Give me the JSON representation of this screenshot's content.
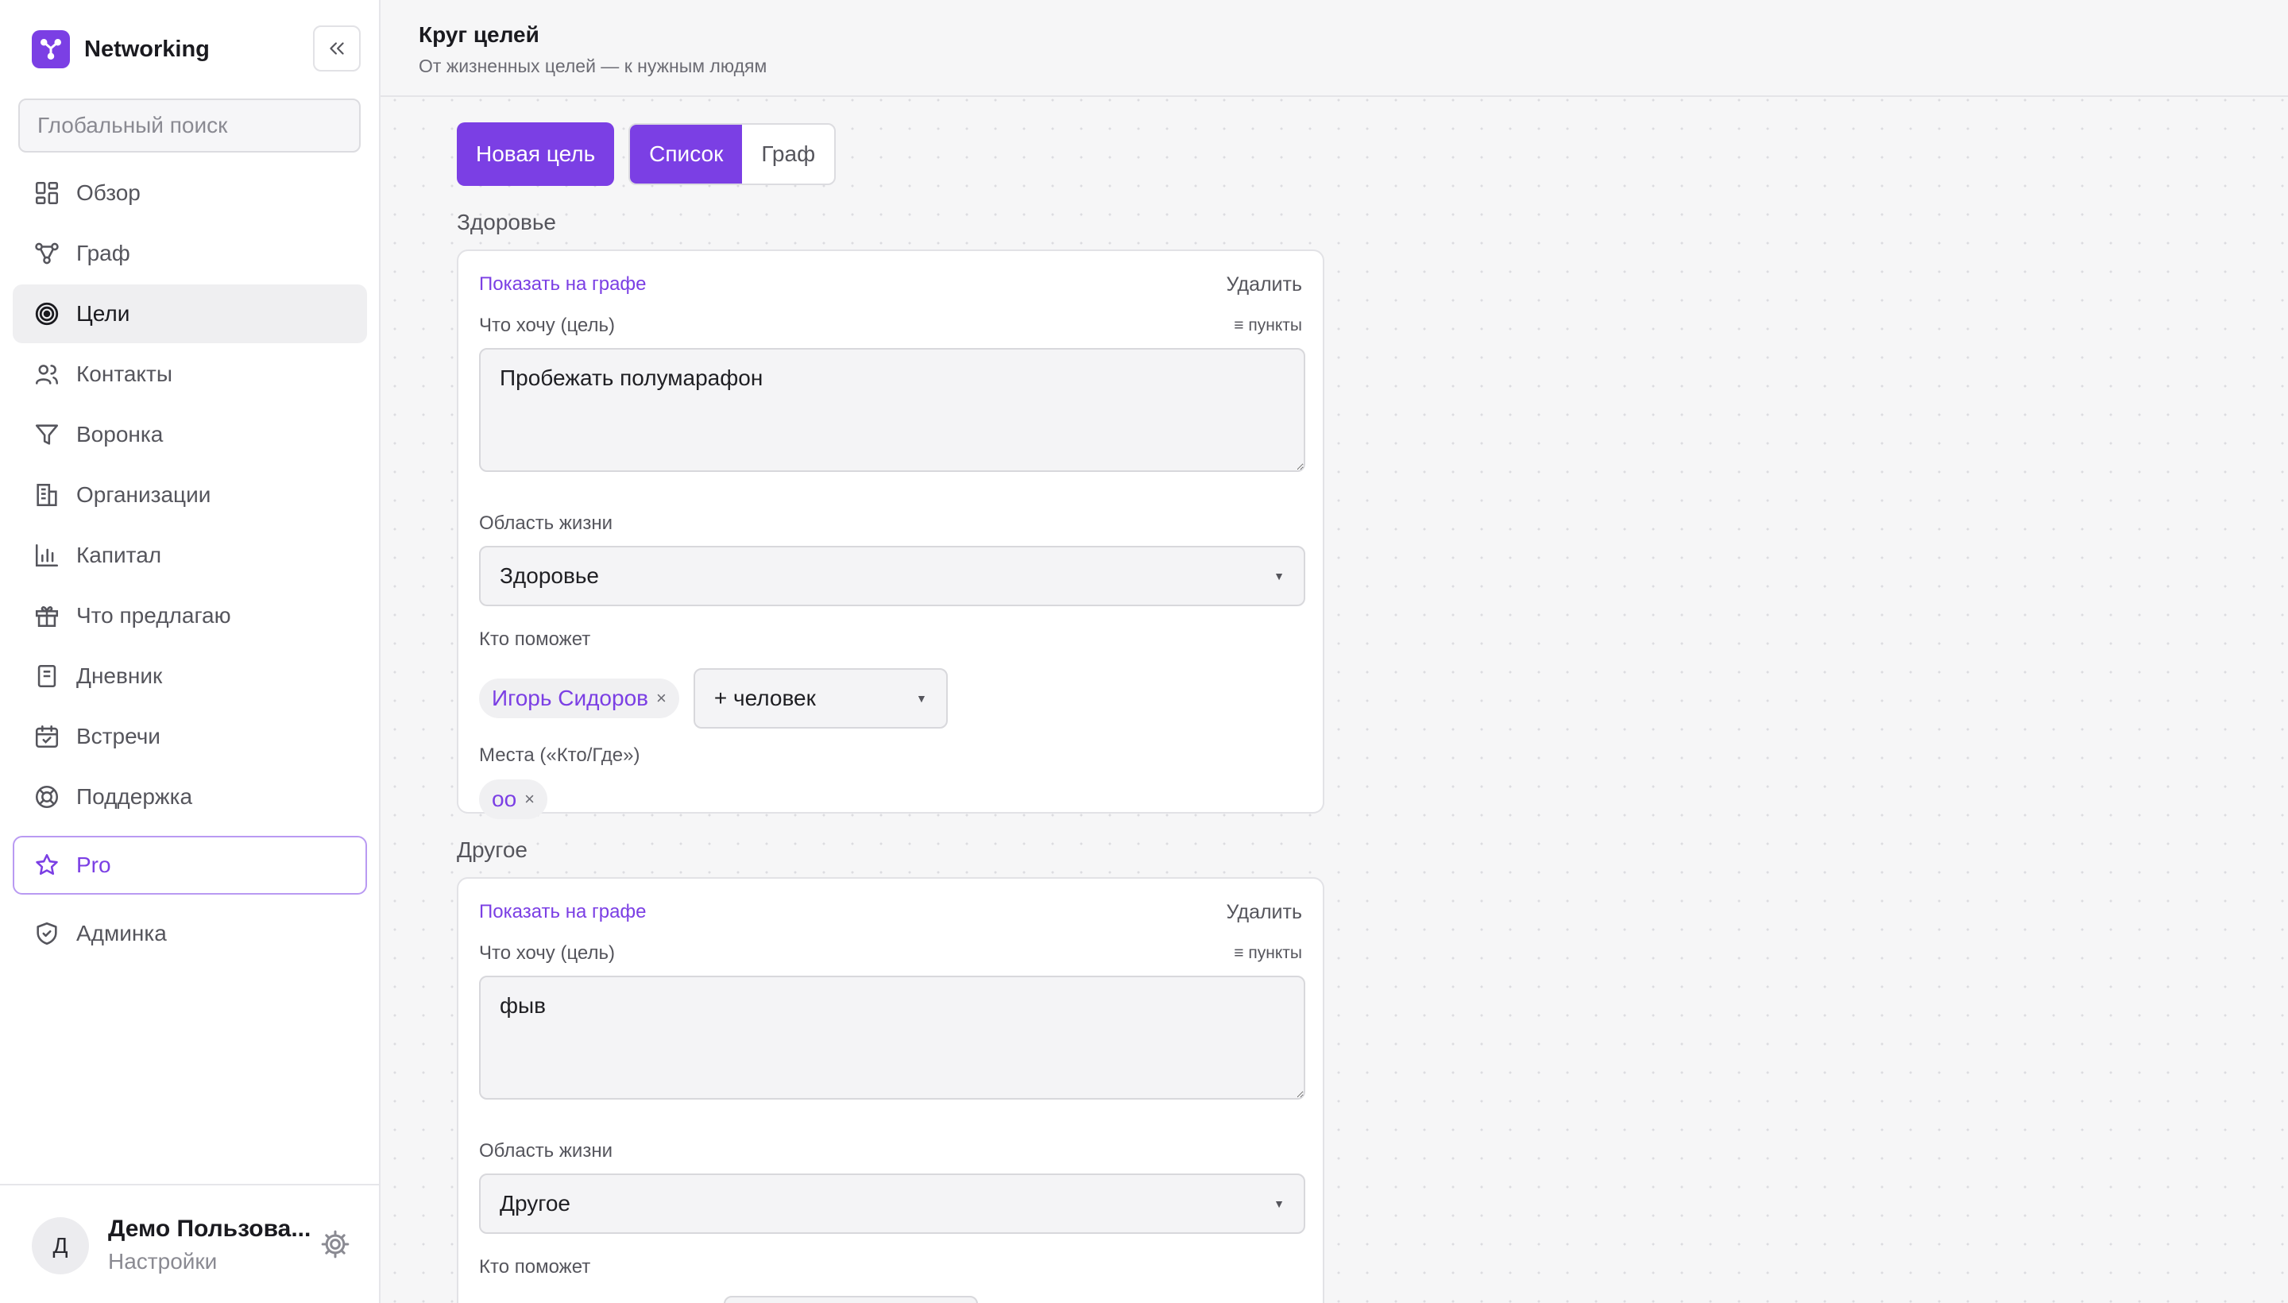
{
  "brand": {
    "name": "Networking"
  },
  "search": {
    "placeholder": "Глобальный поиск"
  },
  "nav": [
    {
      "label": "Обзор",
      "icon": "dashboard-icon"
    },
    {
      "label": "Граф",
      "icon": "graph-icon"
    },
    {
      "label": "Цели",
      "icon": "target-icon",
      "active": true
    },
    {
      "label": "Контакты",
      "icon": "users-icon"
    },
    {
      "label": "Воронка",
      "icon": "funnel-icon"
    },
    {
      "label": "Организации",
      "icon": "building-icon"
    },
    {
      "label": "Капитал",
      "icon": "bar-chart-icon"
    },
    {
      "label": "Что предлагаю",
      "icon": "gift-icon"
    },
    {
      "label": "Дневник",
      "icon": "notebook-icon"
    },
    {
      "label": "Встречи",
      "icon": "calendar-icon"
    },
    {
      "label": "Поддержка",
      "icon": "lifebuoy-icon"
    },
    {
      "label": "Pro",
      "icon": "star-icon"
    },
    {
      "label": "Админка",
      "icon": "shield-icon"
    }
  ],
  "user": {
    "initial": "Д",
    "name": "Демо Пользова...",
    "settings_label": "Настройки"
  },
  "header": {
    "title": "Круг целей",
    "subtitle": "От жизненных целей — к нужным людям"
  },
  "toolbar": {
    "new_goal": "Новая цель",
    "view_list": "Список",
    "view_graph": "Граф",
    "active_view": "Список"
  },
  "groups": [
    {
      "title": "Здоровье",
      "show_on_graph": "Показать на графе",
      "delete": "Удалить",
      "goal_label": "Что хочу (цель)",
      "points_label": "≡ пункты",
      "goal_text": "Пробежать полумарафон",
      "area_label": "Область жизни",
      "area_value": "Здоровье",
      "helpers_label": "Кто поможет",
      "helpers": [
        "Игорь Сидоров"
      ],
      "add_person": "+ человек",
      "places_label": "Места («Кто/Где»)",
      "places": [
        "оо"
      ]
    },
    {
      "title": "Другое",
      "show_on_graph": "Показать на графе",
      "delete": "Удалить",
      "goal_label": "Что хочу (цель)",
      "points_label": "≡ пункты",
      "goal_text": "фыв",
      "area_label": "Область жизни",
      "area_value": "Другое",
      "helpers_label": "Кто поможет"
    }
  ],
  "colors": {
    "accent": "#7b3fe4",
    "sidebar_active_bg": "#efeff1",
    "page_bg": "#f6f6f7"
  }
}
